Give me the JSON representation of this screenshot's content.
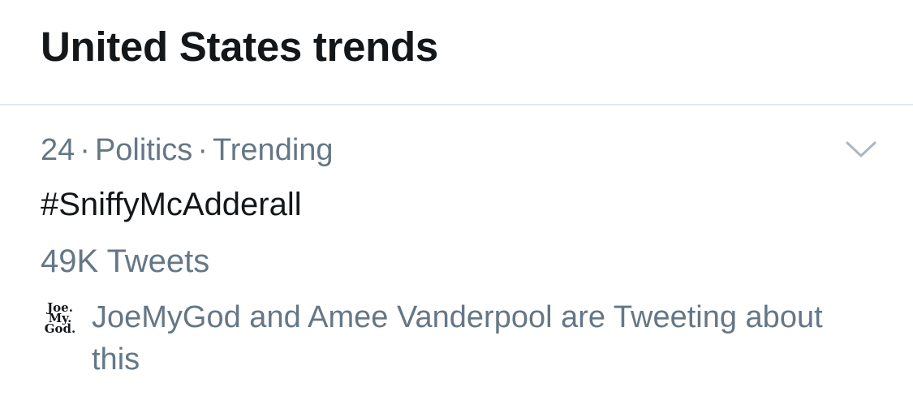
{
  "header": {
    "title": "United States trends"
  },
  "trend": {
    "rank": "24",
    "category": "Politics",
    "status": "Trending",
    "separator": "·",
    "name": "#SniffyMcAdderall",
    "tweet_count": "49K Tweets",
    "social_context": "JoeMyGod and Amee Vanderpool are Tweeting about this",
    "avatar_lines": [
      "Joe.",
      "My.",
      "God."
    ],
    "chevron_icon": "chevron-down-icon"
  },
  "colors": {
    "primary_text": "#14171a",
    "secondary_text": "#657786",
    "divider": "#e1e8ed",
    "chevron": "#aab8c2"
  }
}
